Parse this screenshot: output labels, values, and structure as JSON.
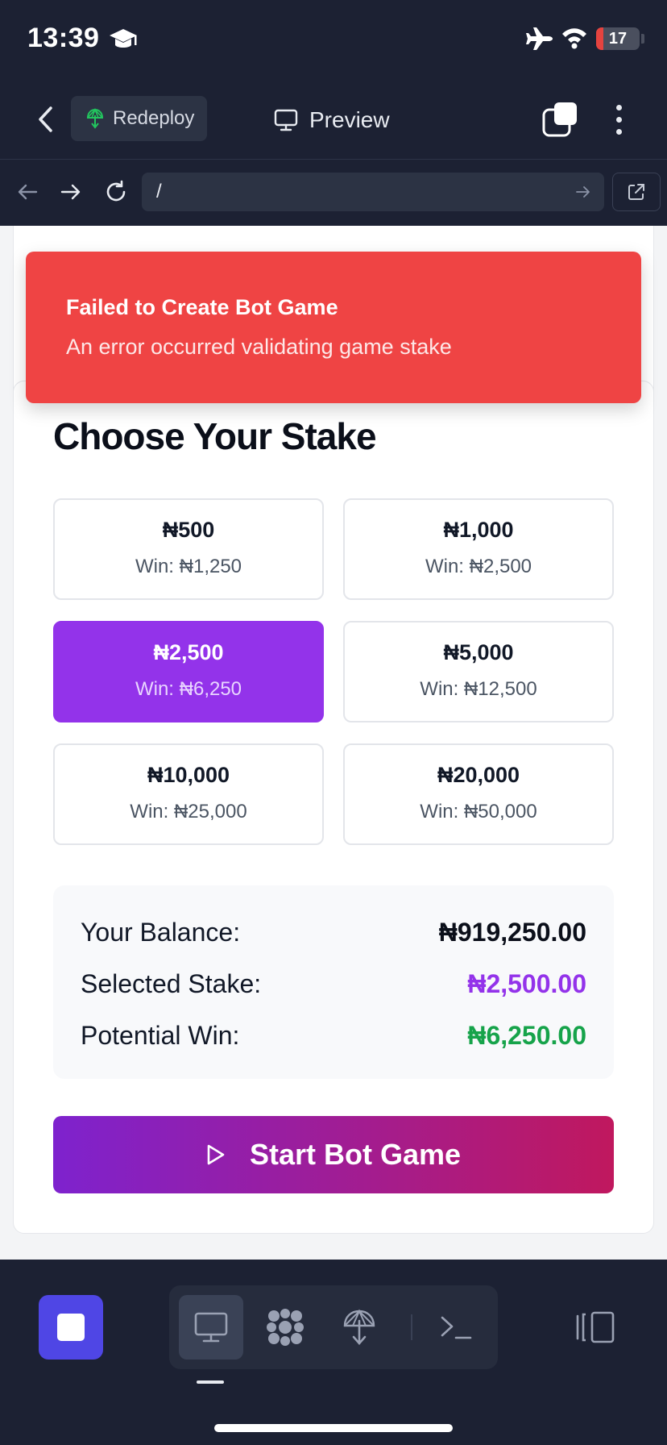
{
  "status_bar": {
    "time": "13:39",
    "battery_level": "17",
    "battery_fraction": 0.17
  },
  "app_bar": {
    "redeploy_label": "Redeploy",
    "title": "Preview"
  },
  "url_bar": {
    "path": "/"
  },
  "toast": {
    "title": "Failed to Create Bot Game",
    "message": "An error occurred validating game stake",
    "color": "#ef4444"
  },
  "stake": {
    "heading": "Choose Your Stake",
    "options": [
      {
        "amount": "₦500",
        "win": "Win: ₦1,250",
        "selected": false
      },
      {
        "amount": "₦1,000",
        "win": "Win: ₦2,500",
        "selected": false
      },
      {
        "amount": "₦2,500",
        "win": "Win: ₦6,250",
        "selected": true
      },
      {
        "amount": "₦5,000",
        "win": "Win: ₦12,500",
        "selected": false
      },
      {
        "amount": "₦10,000",
        "win": "Win: ₦25,000",
        "selected": false
      },
      {
        "amount": "₦20,000",
        "win": "Win: ₦50,000",
        "selected": false
      }
    ],
    "accent_color": "#9333ea"
  },
  "summary": {
    "balance_label": "Your Balance:",
    "balance_value": "₦919,250.00",
    "stake_label": "Selected Stake:",
    "stake_value": "₦2,500.00",
    "win_label": "Potential Win:",
    "win_value": "₦6,250.00",
    "stake_color": "#9333ea",
    "win_color": "#16a34a"
  },
  "start_button": {
    "label": "Start Bot Game"
  },
  "bottom_bar": {
    "tools": [
      "monitor-icon",
      "apps-icon",
      "deploy-icon",
      "terminal-icon"
    ],
    "active_tool": "monitor-icon"
  }
}
